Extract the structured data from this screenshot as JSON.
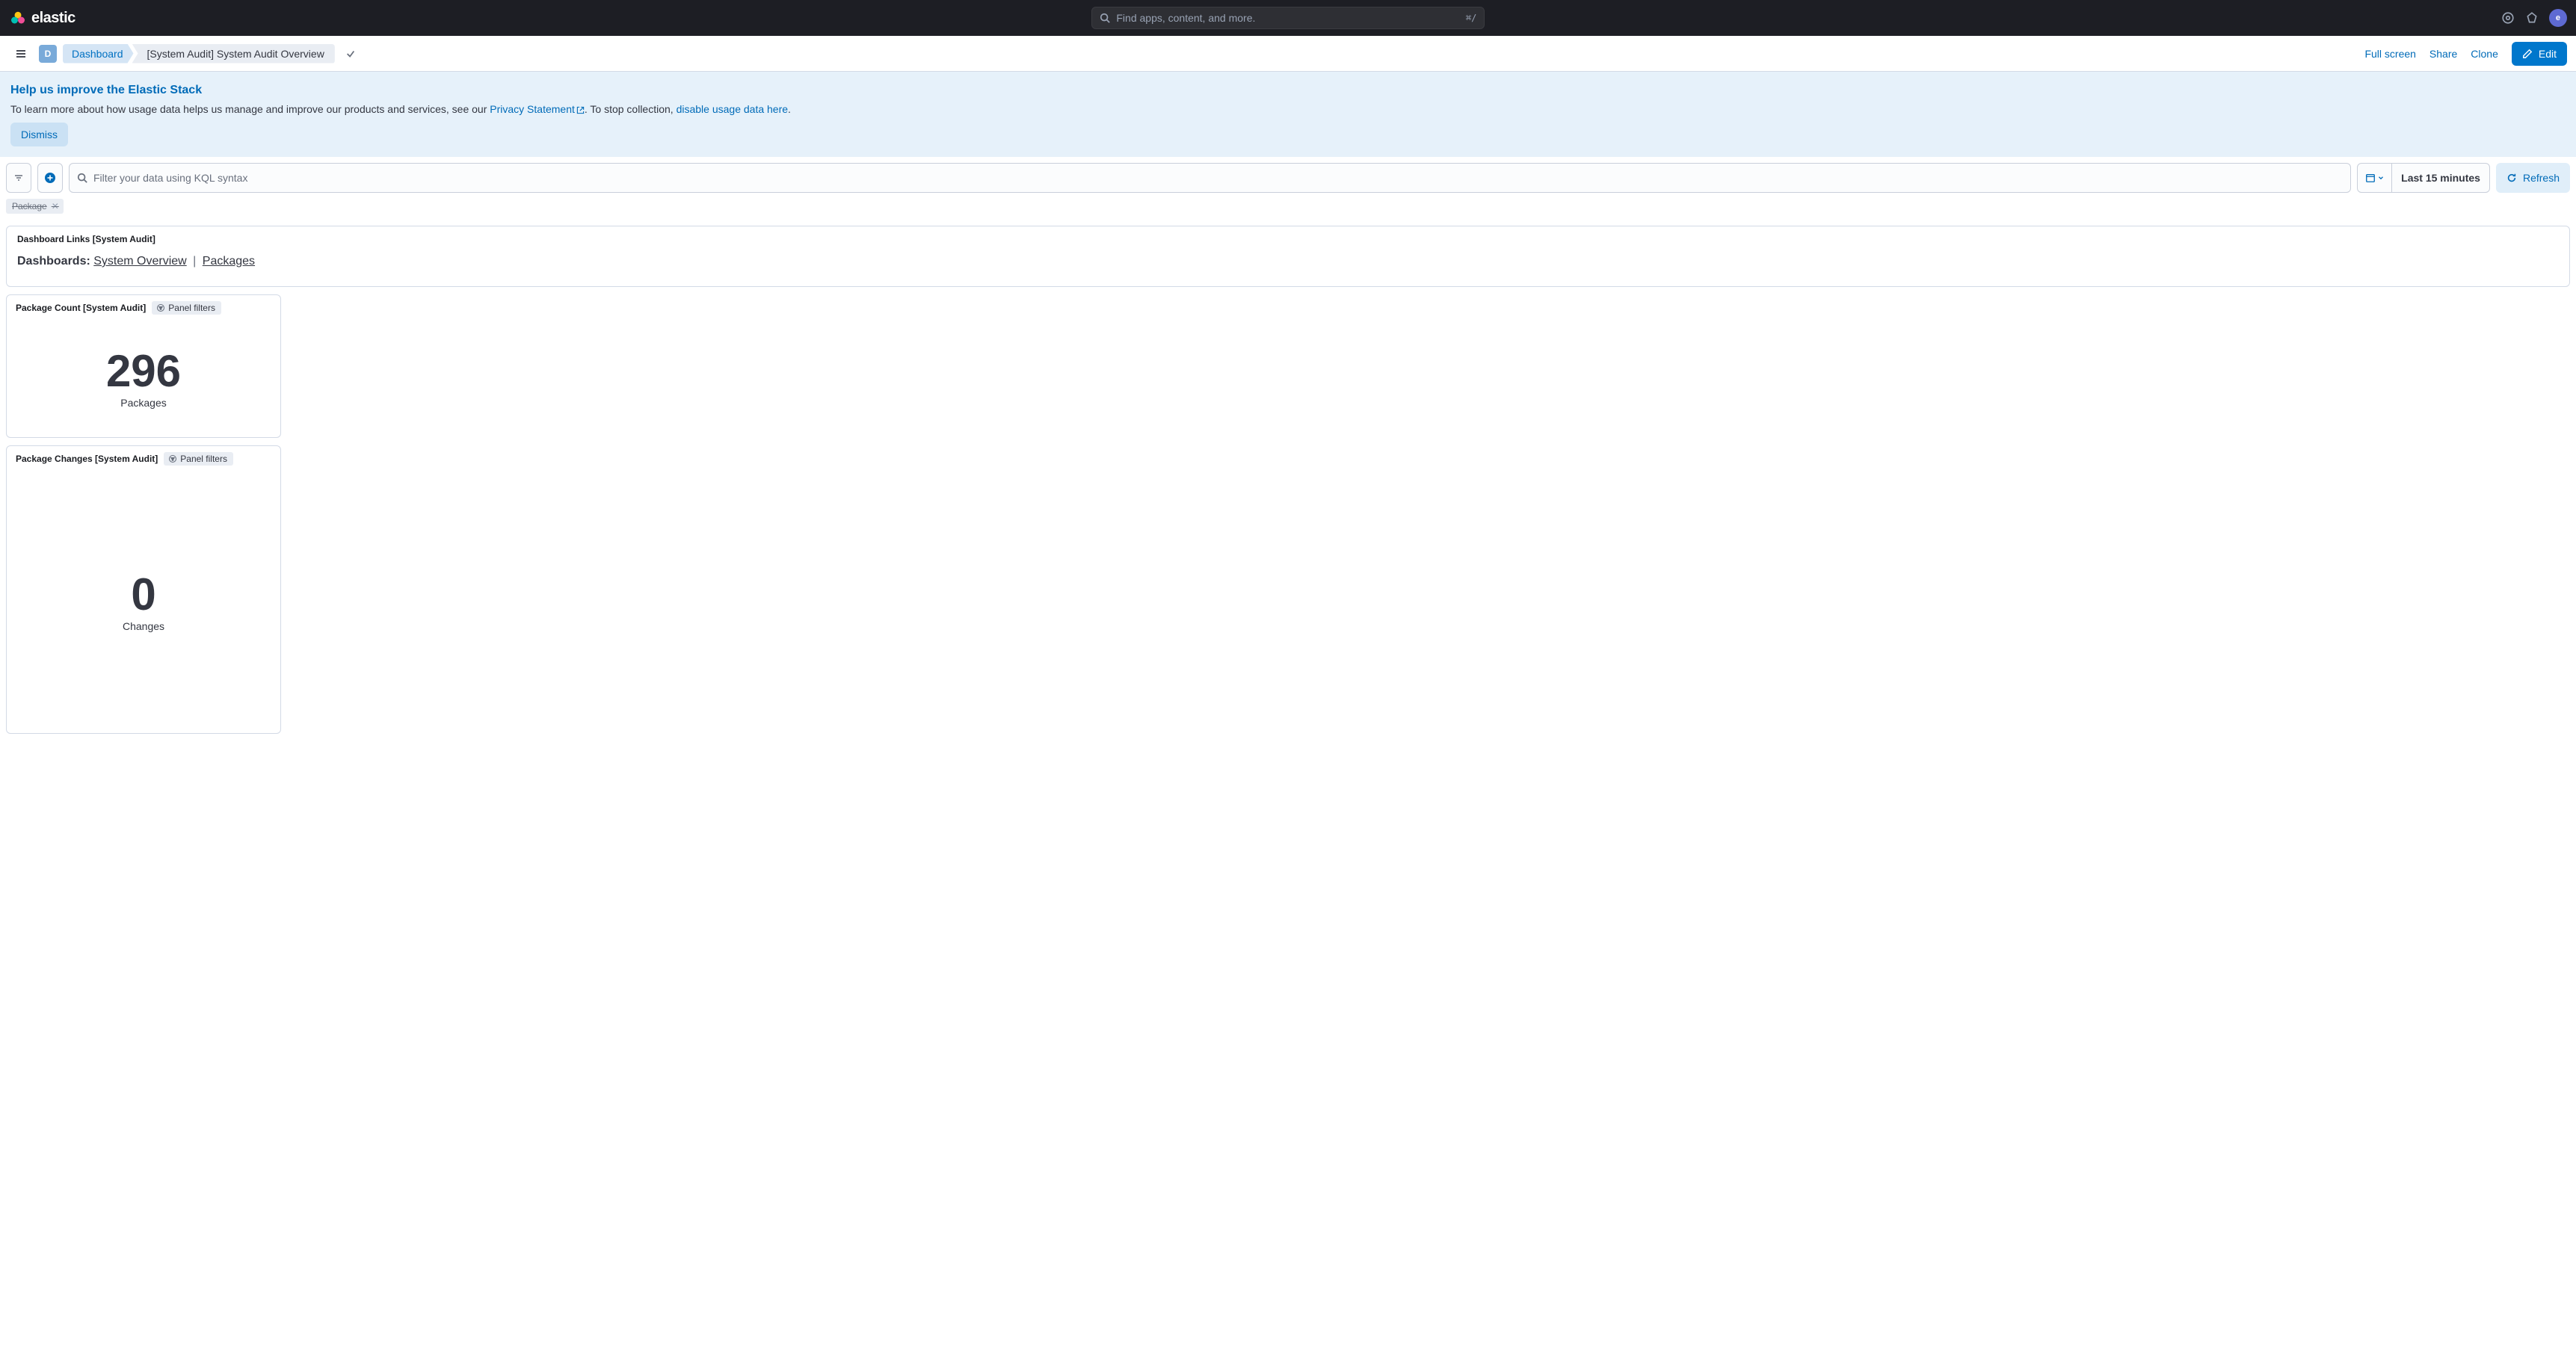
{
  "brand": {
    "name": "elastic"
  },
  "global_search": {
    "placeholder": "Find apps, content, and more.",
    "shortcut": "⌘/"
  },
  "avatar": {
    "initial": "e"
  },
  "app_badge": {
    "letter": "D"
  },
  "breadcrumbs": {
    "first": "Dashboard",
    "last": "[System Audit] System Audit Overview"
  },
  "toolbar": {
    "full_screen": "Full screen",
    "share": "Share",
    "clone": "Clone",
    "edit": "Edit"
  },
  "banner": {
    "title": "Help us improve the Elastic Stack",
    "text_prefix": "To learn more about how usage data helps us manage and improve our products and services, see our ",
    "privacy_link": "Privacy Statement",
    "text_middle": ". To stop collection, ",
    "disable_link": "disable usage data here",
    "text_suffix": ".",
    "dismiss": "Dismiss"
  },
  "query": {
    "kql_placeholder": "Filter your data using KQL syntax",
    "time_label": "Last 15 minutes",
    "refresh": "Refresh"
  },
  "filters": {
    "pill_1": "Package"
  },
  "links_panel": {
    "title": "Dashboard Links [System Audit]",
    "label": "Dashboards",
    "link_1": "System Overview",
    "link_2": "Packages"
  },
  "panel_filters_label": "Panel filters",
  "package_count": {
    "title": "Package Count [System Audit]",
    "value": "296",
    "label": "Packages"
  },
  "package_changes": {
    "title": "Package Changes [System Audit]",
    "value": "0",
    "label": "Changes"
  }
}
